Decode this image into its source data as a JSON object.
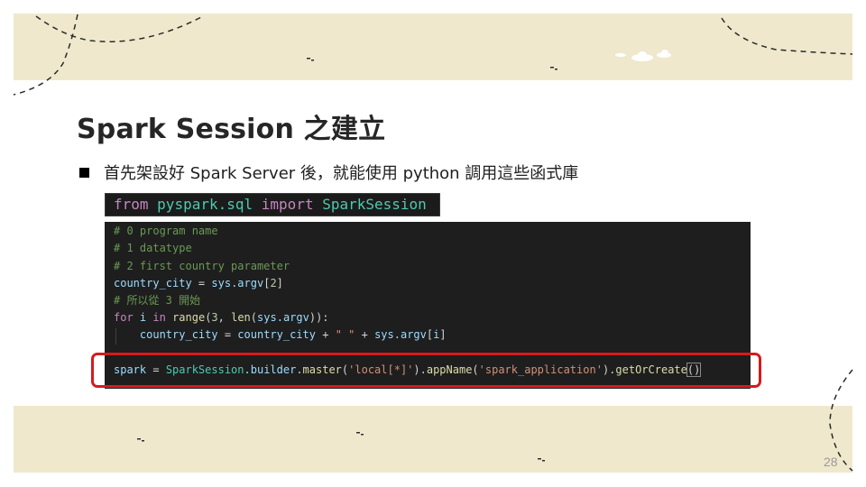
{
  "slide": {
    "title": "Spark Session 之建立",
    "bullet": "首先架設好 Spark Server 後，就能使用 python 調用這些函式庫",
    "page_number": "28"
  },
  "import_code": {
    "kw_from": "from",
    "module": "pyspark.sql",
    "kw_import": "import",
    "class_name": "SparkSession"
  },
  "code": {
    "comment1": "# 0 program name",
    "comment2": "# 1 datatype",
    "comment3": "# 2 first country parameter",
    "line4": {
      "var": "country_city",
      "eq": " = ",
      "obj": "sys",
      "attr": ".argv",
      "open": "[",
      "num": "2",
      "close": "]"
    },
    "comment5": "# 所以從 3 開始",
    "line6": {
      "kw_for": "for",
      "var": " i ",
      "kw_in": "in",
      "sp": " ",
      "fn_range": "range",
      "p1": "(",
      "num": "3",
      "comma": ", ",
      "fn_len": "len",
      "p2": "(",
      "obj": "sys",
      "attr": ".argv",
      "end": ")):"
    },
    "line7": {
      "indent": "    ",
      "var": "country_city",
      "eq": " = ",
      "var2": "country_city",
      "plus1": " + ",
      "str": "\" \"",
      "plus2": " + ",
      "obj": "sys",
      "attr": ".argv",
      "open": "[",
      "idx": "i",
      "close": "]"
    },
    "line8": {
      "var": "spark",
      "eq": " = ",
      "cls": "SparkSession",
      "builder": ".builder.",
      "fn_master": "master",
      "p1": "(",
      "str1": "'local[*]'",
      "p2": ").",
      "fn_appname": "appName",
      "p3": "(",
      "str2": "'spark_application'",
      "p4": ").",
      "fn_get": "getOrCreate",
      "parens": "()"
    }
  },
  "colors": {
    "band": "#efe8cc",
    "highlight": "#d9191c",
    "code_bg": "#1e1e1e"
  }
}
